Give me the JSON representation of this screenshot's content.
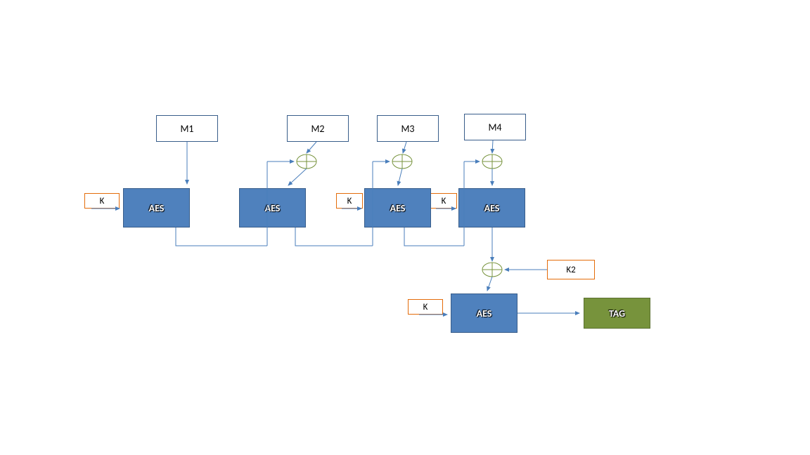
{
  "blocks": {
    "m1": "M1",
    "m2": "M2",
    "m3": "M3",
    "m4": "M4",
    "k_top": "K",
    "k_mid1": "K",
    "k_mid2": "K",
    "k_bottom": "K",
    "k2": "K2",
    "aes1": "AES",
    "aes2": "AES",
    "aes3": "AES",
    "aes4": "AES",
    "aes5": "AES",
    "tag": "TAG"
  },
  "colors": {
    "line": "#4a7ebb",
    "aes_fill": "#4f81bd",
    "tag_fill": "#77933c",
    "k_border": "#e46c0a",
    "m_border": "#385d8a"
  }
}
